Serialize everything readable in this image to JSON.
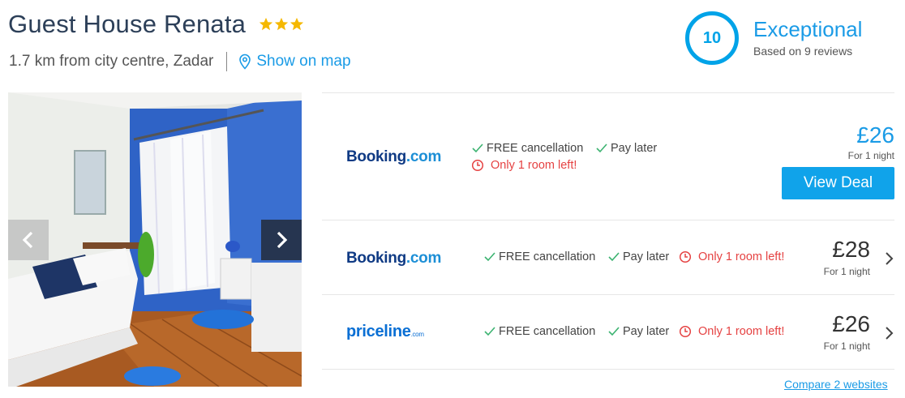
{
  "hotel": {
    "name": "Guest House Renata",
    "stars": 3,
    "distance": "1.7 km from city centre, Zadar",
    "map_link": "Show on map"
  },
  "rating": {
    "score": "10",
    "label": "Exceptional",
    "reviews": "Based on 9 reviews"
  },
  "gallery": {
    "prev_icon": "chevron-left-icon",
    "next_icon": "chevron-right-icon"
  },
  "deals": [
    {
      "provider_brand": "Booking",
      "provider_suffix": ".com",
      "features": [
        "FREE cancellation",
        "Pay later"
      ],
      "warning": "Only 1 room left!",
      "price": "£26",
      "per": "For 1 night",
      "button": "View Deal"
    },
    {
      "provider_brand": "Booking",
      "provider_suffix": ".com",
      "features": [
        "FREE cancellation",
        "Pay later"
      ],
      "warning": "Only 1 room left!",
      "price": "£28",
      "per": "For 1 night"
    },
    {
      "provider_brand": "priceline",
      "provider_suffix": ".com",
      "features": [
        "FREE cancellation",
        "Pay later"
      ],
      "warning": "Only 1 room left!",
      "price": "£26",
      "per": "For 1 night"
    }
  ],
  "compare_link": "Compare 2 websites",
  "colors": {
    "accent": "#1a9be6",
    "star": "#f5b800",
    "warning": "#e54242",
    "check": "#3cb371"
  }
}
